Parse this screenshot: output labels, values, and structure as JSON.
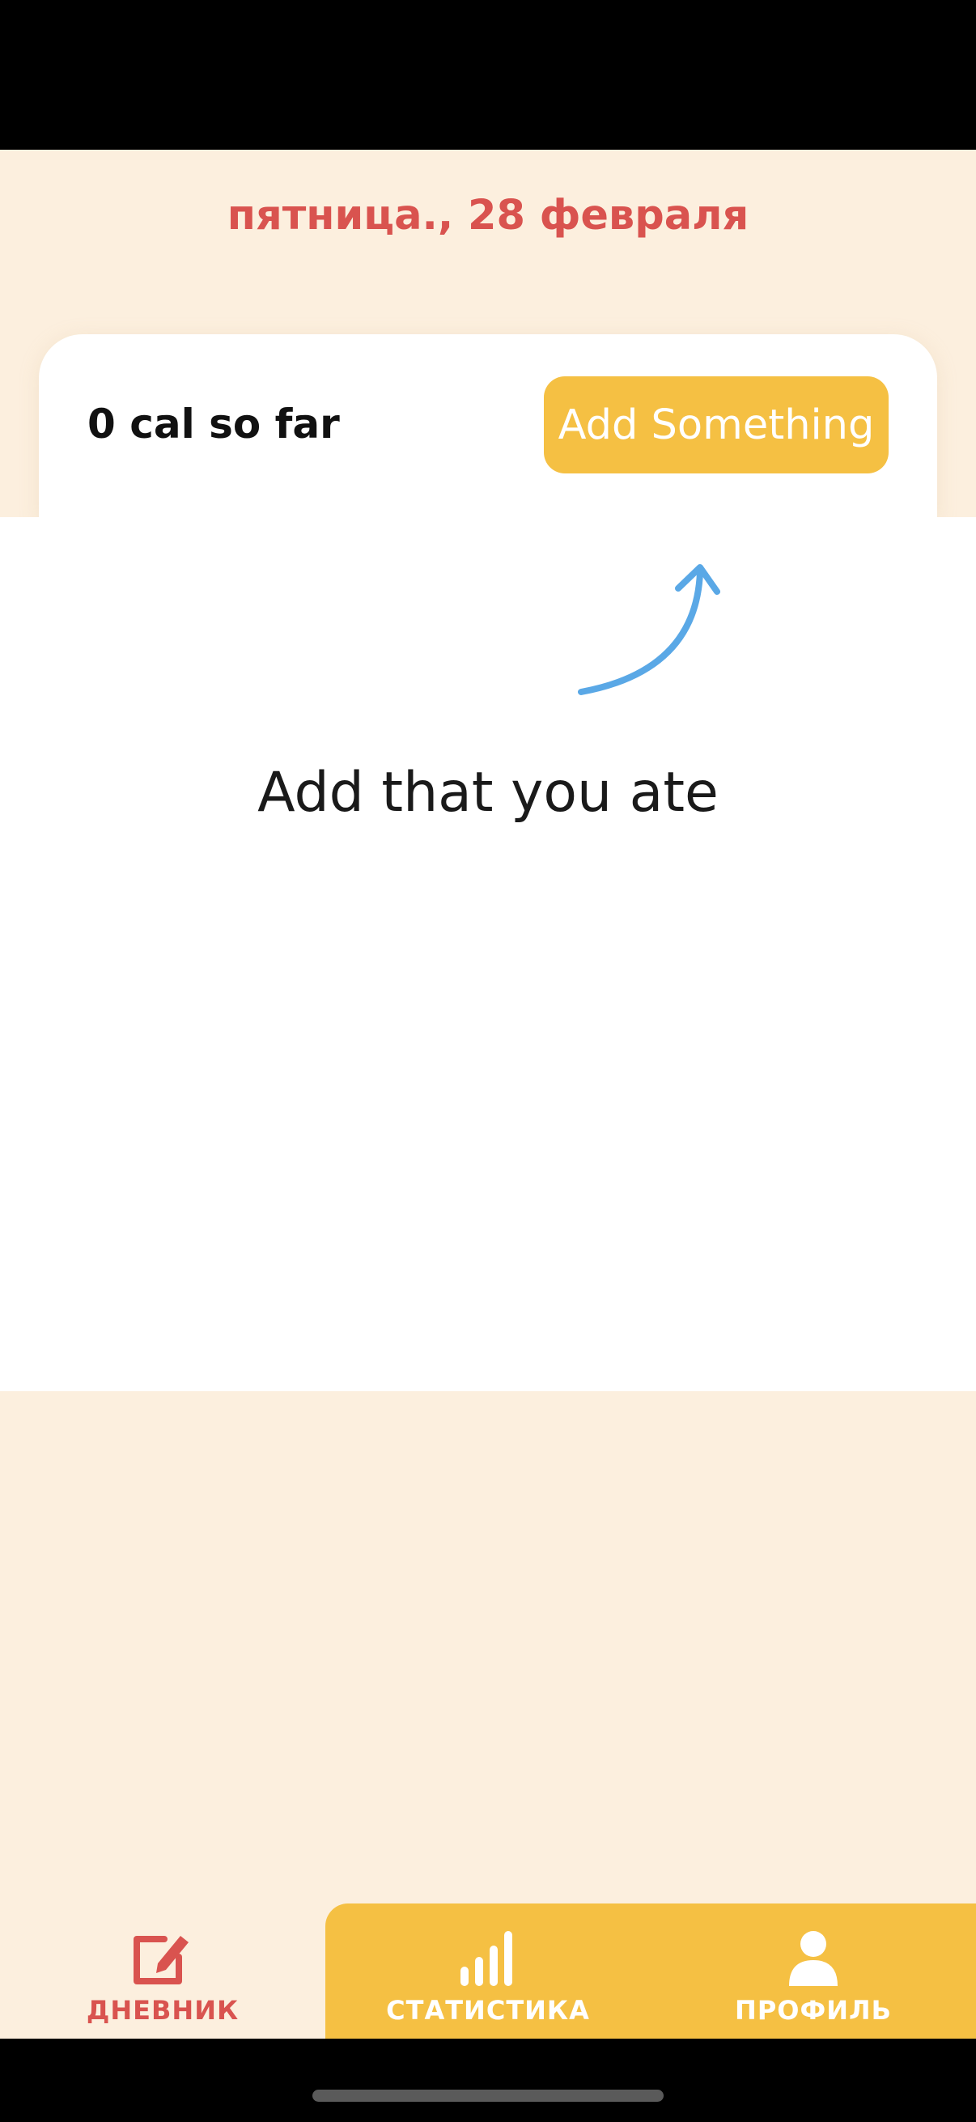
{
  "header": {
    "date": "пятница., 28 февраля"
  },
  "summary": {
    "calories_text": "0 cal so far",
    "add_button_label": "Add Something"
  },
  "empty_state": {
    "hint": "Add that you ate",
    "arrow_color": "#5AA8E6"
  },
  "tabs": [
    {
      "id": "diary",
      "label": "ДНЕВНИК",
      "icon": "edit-icon",
      "active": true
    },
    {
      "id": "stats",
      "label": "СТАТИСТИКА",
      "icon": "bar-chart-icon",
      "active": false
    },
    {
      "id": "profile",
      "label": "ПРОФИЛЬ",
      "icon": "user-icon",
      "active": false
    }
  ],
  "colors": {
    "background": "#FCEFDE",
    "accent": "#F5C043",
    "primary_red": "#D9534F",
    "text_dark": "#111111"
  }
}
